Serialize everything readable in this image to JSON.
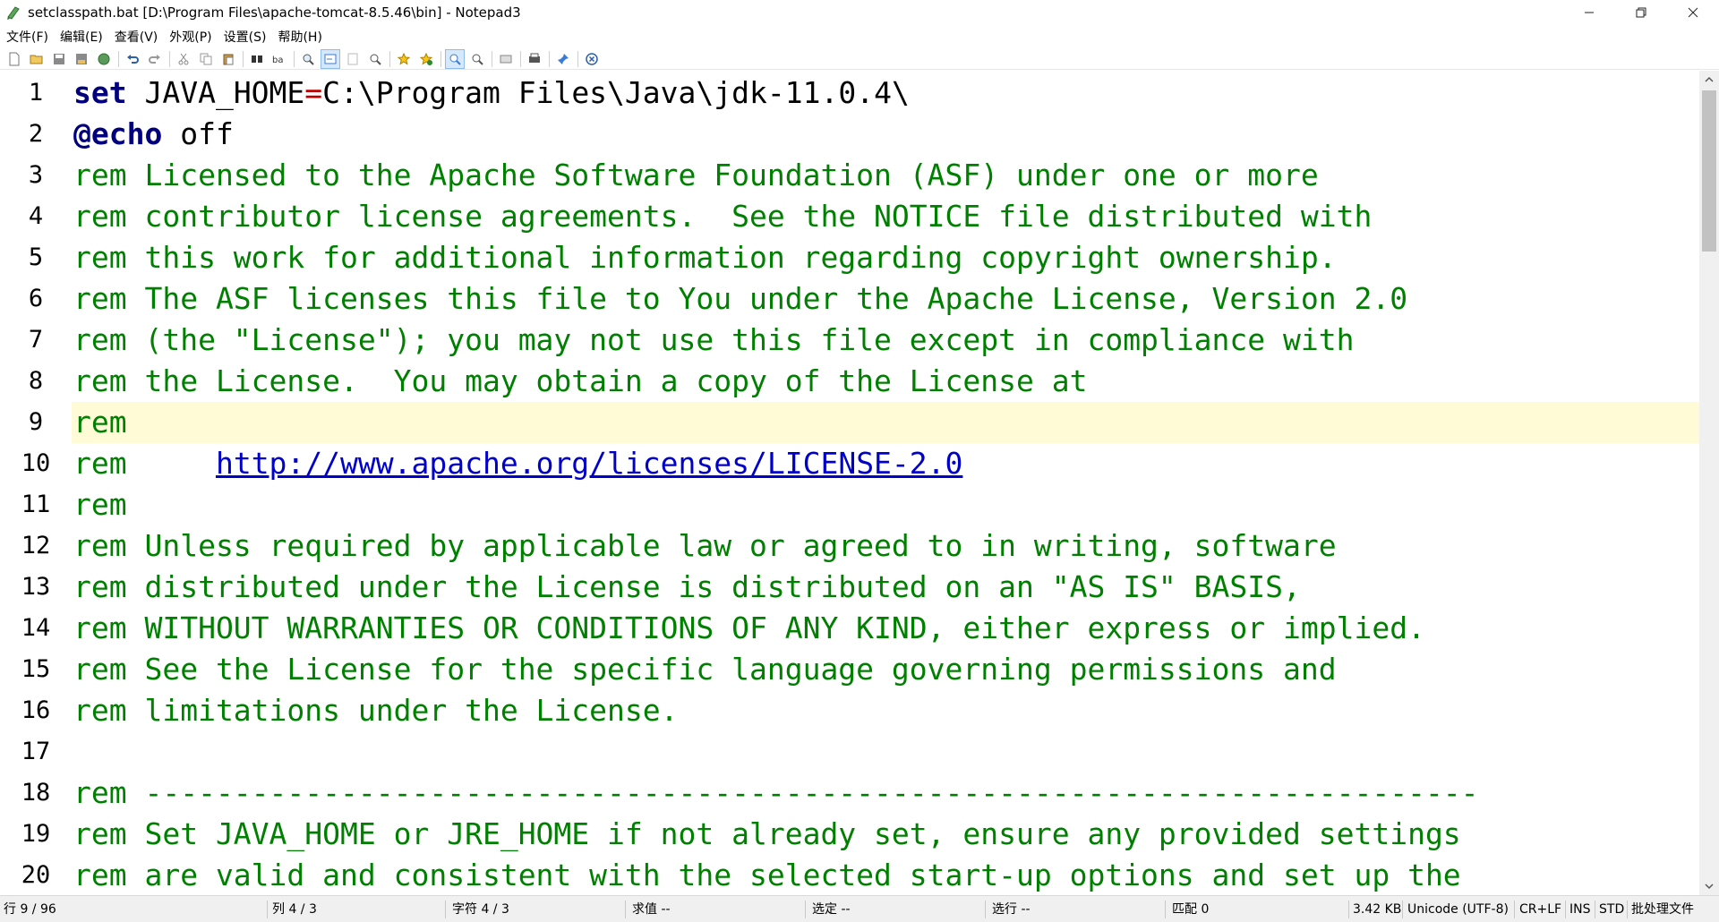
{
  "window": {
    "title": "setclasspath.bat [D:\\Program Files\\apache-tomcat-8.5.46\\bin] - Notepad3"
  },
  "menu": [
    "文件(F)",
    "编辑(E)",
    "查看(V)",
    "外观(P)",
    "设置(S)",
    "帮助(H)"
  ],
  "toolbar": {
    "icons": [
      "new-file-icon",
      "open-file-icon",
      "save-icon",
      "save-as-icon",
      "browse-icon",
      "undo-icon",
      "redo-icon",
      "cut-icon",
      "copy-icon",
      "paste-icon",
      "find-icon",
      "replace-icon",
      "find-next-icon",
      "word-wrap-icon",
      "block-icon",
      "zoom-icon",
      "favorite-icon",
      "add-favorite-icon",
      "zoom-in-icon",
      "zoom-out-icon",
      "page-setup-icon",
      "print-icon",
      "pin-icon",
      "close-doc-icon"
    ]
  },
  "editor": {
    "current_line": 9,
    "lines": [
      {
        "n": "1",
        "parts": [
          {
            "t": "set",
            "c": "kw"
          },
          {
            "t": " JAVA_HOME",
            "c": "plain"
          },
          {
            "t": "=",
            "c": "op"
          },
          {
            "t": "C:\\Program Files\\Java\\jdk-11.0.4\\",
            "c": "plain"
          }
        ]
      },
      {
        "n": "2",
        "parts": [
          {
            "t": "@echo",
            "c": "kw"
          },
          {
            "t": " off",
            "c": "plain"
          }
        ]
      },
      {
        "n": "3",
        "parts": [
          {
            "t": "rem Licensed to the Apache Software Foundation (ASF) under one or more",
            "c": ""
          }
        ]
      },
      {
        "n": "4",
        "parts": [
          {
            "t": "rem contributor license agreements.  See the NOTICE file distributed with",
            "c": ""
          }
        ]
      },
      {
        "n": "5",
        "parts": [
          {
            "t": "rem this work for additional information regarding copyright ownership.",
            "c": ""
          }
        ]
      },
      {
        "n": "6",
        "parts": [
          {
            "t": "rem The ASF licenses this file to You under the Apache License, Version 2.0",
            "c": ""
          }
        ]
      },
      {
        "n": "7",
        "parts": [
          {
            "t": "rem (the \"License\"); you may not use this file except in compliance with",
            "c": ""
          }
        ]
      },
      {
        "n": "8",
        "parts": [
          {
            "t": "rem the License.  You may obtain a copy of the License at",
            "c": ""
          }
        ]
      },
      {
        "n": "9",
        "parts": [
          {
            "t": "rem",
            "c": ""
          }
        ]
      },
      {
        "n": "10",
        "parts": [
          {
            "t": "rem     ",
            "c": ""
          },
          {
            "t": "http://www.apache.org/licenses/LICENSE-2.0",
            "c": "link"
          }
        ]
      },
      {
        "n": "11",
        "parts": [
          {
            "t": "rem",
            "c": ""
          }
        ]
      },
      {
        "n": "12",
        "parts": [
          {
            "t": "rem Unless required by applicable law or agreed to in writing, software",
            "c": ""
          }
        ]
      },
      {
        "n": "13",
        "parts": [
          {
            "t": "rem distributed under the License is distributed on an \"AS IS\" BASIS,",
            "c": ""
          }
        ]
      },
      {
        "n": "14",
        "parts": [
          {
            "t": "rem WITHOUT WARRANTIES OR CONDITIONS OF ANY KIND, either express or implied.",
            "c": ""
          }
        ]
      },
      {
        "n": "15",
        "parts": [
          {
            "t": "rem See the License for the specific language governing permissions and",
            "c": ""
          }
        ]
      },
      {
        "n": "16",
        "parts": [
          {
            "t": "rem limitations under the License.",
            "c": ""
          }
        ]
      },
      {
        "n": "17",
        "parts": []
      },
      {
        "n": "18",
        "parts": [
          {
            "t": "rem ---------------------------------------------------------------------------",
            "c": ""
          }
        ]
      },
      {
        "n": "19",
        "parts": [
          {
            "t": "rem Set JAVA_HOME or JRE_HOME if not already set, ensure any provided settings",
            "c": ""
          }
        ]
      },
      {
        "n": "20",
        "parts": [
          {
            "t": "rem are valid and consistent with the selected start-up options and set up the",
            "c": ""
          }
        ]
      }
    ]
  },
  "status": {
    "line": "行 9 / 96",
    "col": "列 4 / 3",
    "char": "字符 4 / 3",
    "eval": "求值 --",
    "sel": "选定 --",
    "sel_lines": "选行 --",
    "match": "匹配 0",
    "size": "3.42 KB",
    "encoding": "Unicode (UTF-8)",
    "eol": "CR+LF",
    "ins": "INS",
    "std": "STD",
    "lexer": "批处理文件"
  },
  "colors": {
    "comment": "#008000",
    "keyword": "#00007f",
    "link": "#0000cc",
    "current_line": "#fffbd6"
  }
}
